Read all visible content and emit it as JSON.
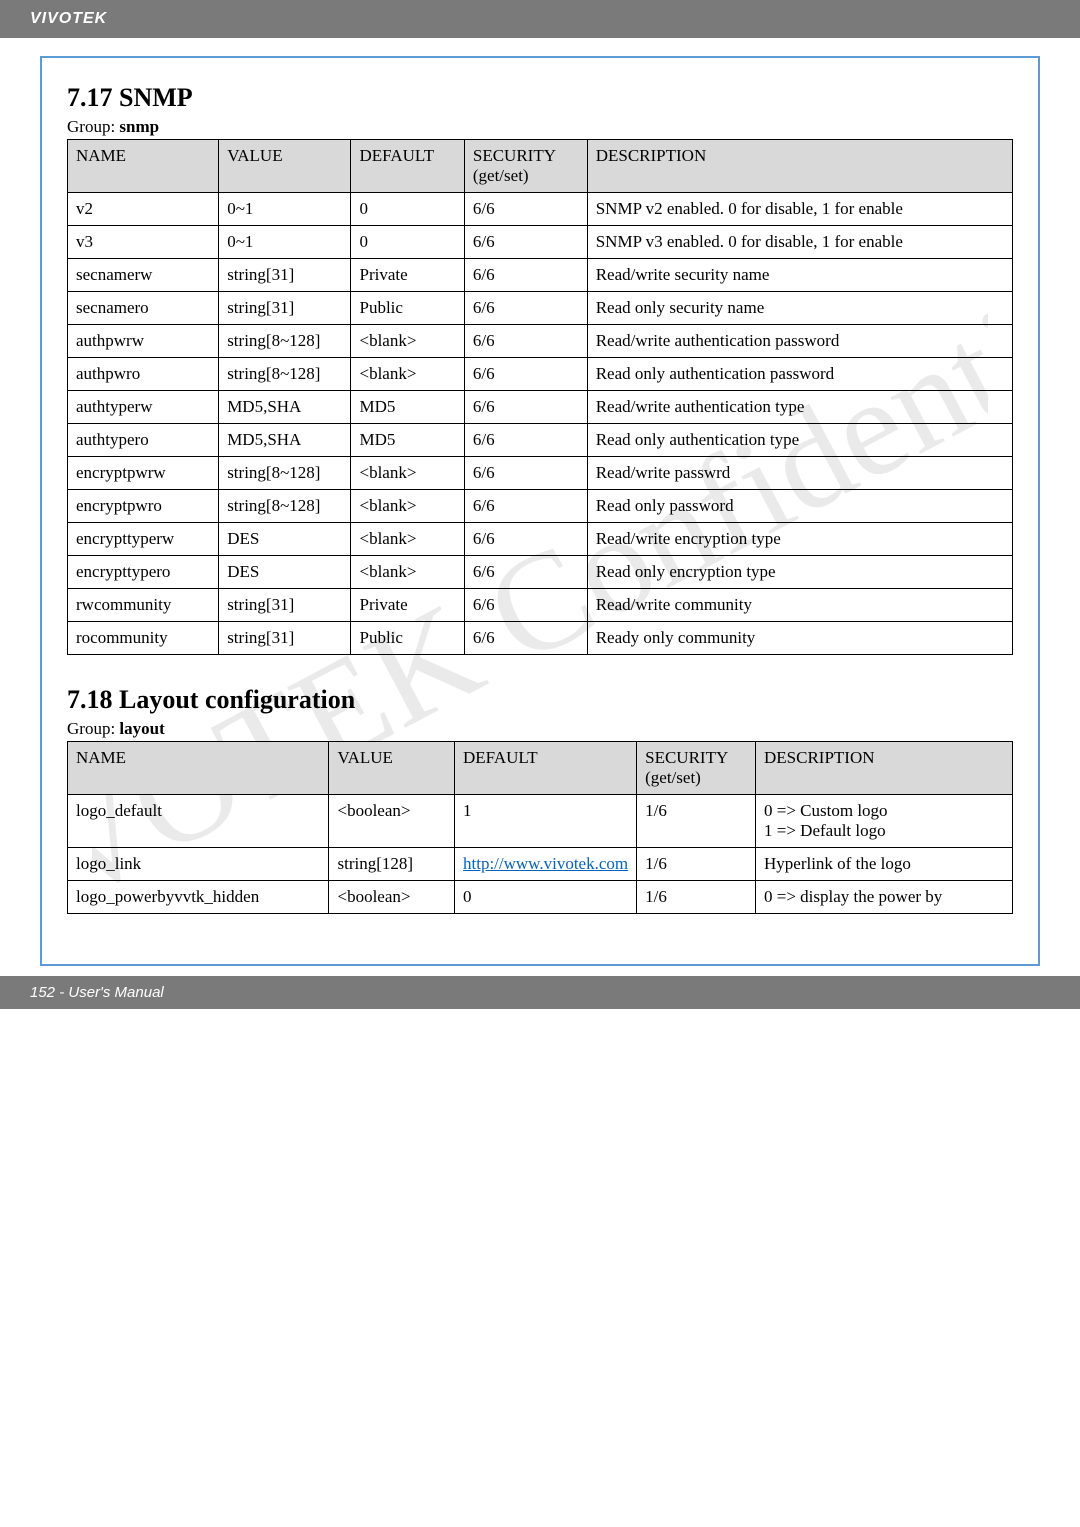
{
  "top_bar": {
    "brand": "VIVOTEK"
  },
  "footer": {
    "text": "152 - User's Manual"
  },
  "sections": {
    "snmp": {
      "heading": "7.17 SNMP",
      "group_label": "Group: ",
      "group_name": "snmp",
      "columns": {
        "name": "NAME",
        "value": "VALUE",
        "default": "DEFAULT",
        "security": "SECURITY (get/set)",
        "description": "DESCRIPTION"
      },
      "rows": [
        {
          "name": "v2",
          "value": "0~1",
          "default": "0",
          "security": "6/6",
          "description": "SNMP v2 enabled. 0 for disable, 1 for enable"
        },
        {
          "name": "v3",
          "value": "0~1",
          "default": "0",
          "security": "6/6",
          "description": "SNMP v3 enabled. 0 for disable, 1 for enable"
        },
        {
          "name": "secnamerw",
          "value": "string[31]",
          "default": "Private",
          "security": "6/6",
          "description": "Read/write security name"
        },
        {
          "name": "secnamero",
          "value": "string[31]",
          "default": "Public",
          "security": "6/6",
          "description": "Read only security name"
        },
        {
          "name": "authpwrw",
          "value": "string[8~128]",
          "default": "<blank>",
          "security": "6/6",
          "description": "Read/write authentication password"
        },
        {
          "name": "authpwro",
          "value": "string[8~128]",
          "default": "<blank>",
          "security": "6/6",
          "description": "Read only authentication password"
        },
        {
          "name": "authtyperw",
          "value": "MD5,SHA",
          "default": "MD5",
          "security": "6/6",
          "description": "Read/write authentication type"
        },
        {
          "name": "authtypero",
          "value": "MD5,SHA",
          "default": "MD5",
          "security": "6/6",
          "description": "Read only authentication type"
        },
        {
          "name": "encryptpwrw",
          "value": "string[8~128]",
          "default": "<blank>",
          "security": "6/6",
          "description": "Read/write passwrd"
        },
        {
          "name": "encryptpwro",
          "value": "string[8~128]",
          "default": "<blank>",
          "security": "6/6",
          "description": "Read only password"
        },
        {
          "name": "encrypttyperw",
          "value": "DES",
          "default": "<blank>",
          "security": "6/6",
          "description": "Read/write encryption type"
        },
        {
          "name": "encrypttypero",
          "value": "DES",
          "default": "<blank>",
          "security": "6/6",
          "description": "Read only encryption type"
        },
        {
          "name": "rwcommunity",
          "value": "string[31]",
          "default": "Private",
          "security": "6/6",
          "description": "Read/write community"
        },
        {
          "name": "rocommunity",
          "value": "string[31]",
          "default": "Public",
          "security": "6/6",
          "description": "Ready only community"
        }
      ]
    },
    "layout": {
      "heading": "7.18 Layout configuration",
      "group_label": "Group: ",
      "group_name": "layout",
      "columns": {
        "name": "NAME",
        "value": "VALUE",
        "default": "DEFAULT",
        "security": "SECURITY (get/set)",
        "description": "DESCRIPTION"
      },
      "rows": [
        {
          "name": "logo_default",
          "value": "<boolean>",
          "default_is_url": false,
          "default": "1",
          "security": "1/6",
          "description": "0 => Custom logo\n1 => Default logo"
        },
        {
          "name": "logo_link",
          "value": "string[128]",
          "default_is_url": true,
          "default": "http://www.vivotek.com",
          "security": "1/6",
          "description": "Hyperlink of the logo"
        },
        {
          "name": "logo_powerbyvvtk_hidden",
          "value": "<boolean>",
          "default_is_url": false,
          "default": "0",
          "security": "1/6",
          "description": "0 => display the power by"
        }
      ]
    }
  }
}
